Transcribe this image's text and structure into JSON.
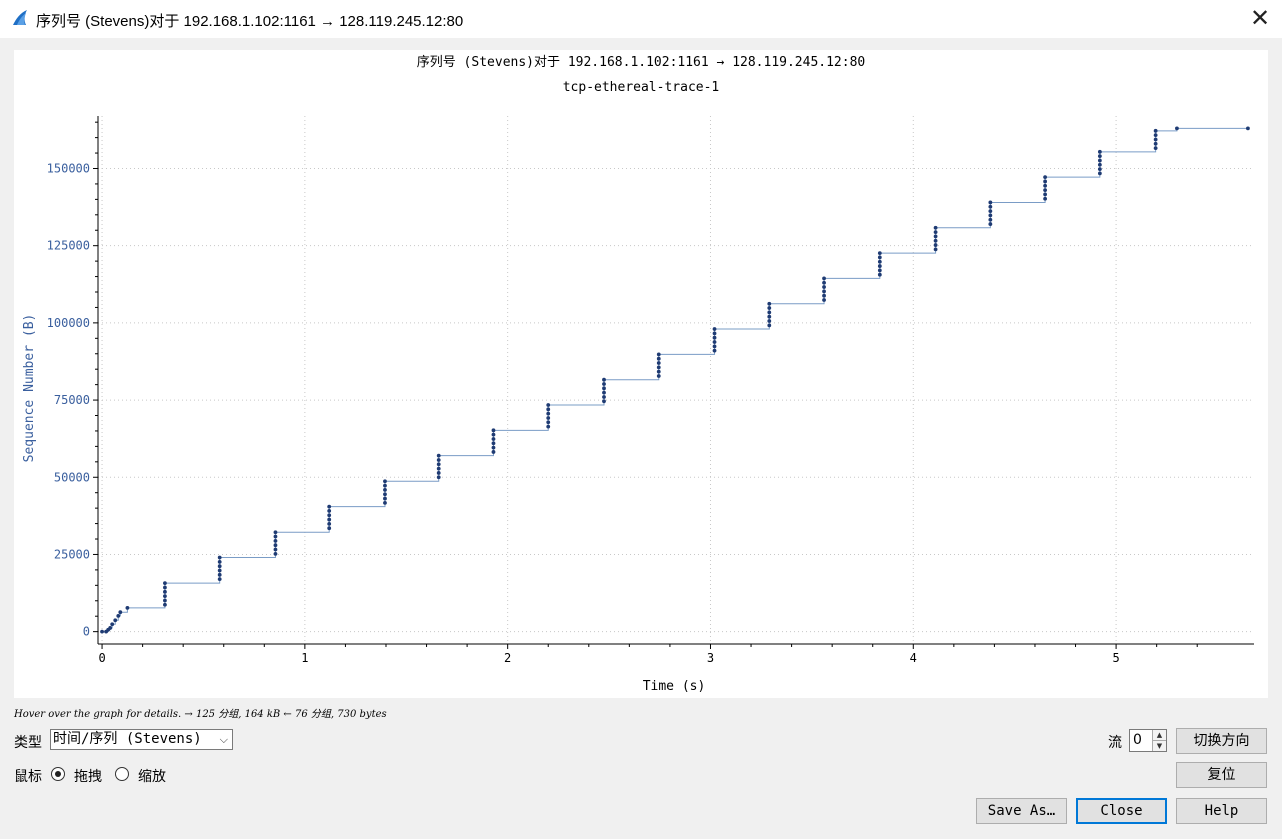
{
  "window": {
    "title": "序列号 (Stevens)对于 192.168.1.102:1161 → 128.119.245.12:80",
    "close_glyph": "✕"
  },
  "plot": {
    "title": "序列号 (Stevens)对于 192.168.1.102:1161 → 128.119.245.12:80",
    "subtitle": "tcp-ethereal-trace-1"
  },
  "chart_data": {
    "type": "scatter",
    "title": "序列号 (Stevens)对于 192.168.1.102:1161 → 128.119.245.12:80",
    "subtitle": "tcp-ethereal-trace-1",
    "xlabel": "Time (s)",
    "ylabel": "Sequence Number (B)",
    "xlim": [
      -0.02,
      5.68
    ],
    "ylim": [
      -4000,
      167000
    ],
    "x_ticks": [
      0,
      1,
      2,
      3,
      4,
      5
    ],
    "y_ticks": [
      0,
      25000,
      50000,
      75000,
      100000,
      125000,
      150000
    ],
    "grid": true,
    "line_color": "#7a9cc6",
    "point_color": "#1f3b73",
    "points": [
      [
        0.0,
        0
      ],
      [
        0.02,
        0
      ],
      [
        0.03,
        600
      ],
      [
        0.04,
        1200
      ],
      [
        0.05,
        2400
      ],
      [
        0.065,
        3700
      ],
      [
        0.08,
        5100
      ],
      [
        0.09,
        6300
      ],
      [
        0.125,
        7700
      ],
      [
        0.31,
        8700
      ],
      [
        0.31,
        10100
      ],
      [
        0.31,
        11500
      ],
      [
        0.31,
        12900
      ],
      [
        0.31,
        14300
      ],
      [
        0.31,
        15700
      ],
      [
        0.58,
        17000
      ],
      [
        0.58,
        18400
      ],
      [
        0.58,
        19800
      ],
      [
        0.58,
        21200
      ],
      [
        0.58,
        22600
      ],
      [
        0.58,
        24000
      ],
      [
        0.855,
        25200
      ],
      [
        0.855,
        26600
      ],
      [
        0.855,
        28000
      ],
      [
        0.855,
        29400
      ],
      [
        0.855,
        30800
      ],
      [
        0.855,
        32200
      ],
      [
        1.12,
        33500
      ],
      [
        1.12,
        34900
      ],
      [
        1.12,
        36300
      ],
      [
        1.12,
        37700
      ],
      [
        1.12,
        39100
      ],
      [
        1.12,
        40500
      ],
      [
        1.395,
        41700
      ],
      [
        1.395,
        43100
      ],
      [
        1.395,
        44500
      ],
      [
        1.395,
        45900
      ],
      [
        1.395,
        47300
      ],
      [
        1.395,
        48700
      ],
      [
        1.66,
        50000
      ],
      [
        1.66,
        51400
      ],
      [
        1.66,
        52800
      ],
      [
        1.66,
        54200
      ],
      [
        1.66,
        55600
      ],
      [
        1.66,
        57000
      ],
      [
        1.93,
        58200
      ],
      [
        1.93,
        59600
      ],
      [
        1.93,
        61000
      ],
      [
        1.93,
        62400
      ],
      [
        1.93,
        63800
      ],
      [
        1.93,
        65200
      ],
      [
        2.2,
        66400
      ],
      [
        2.2,
        67800
      ],
      [
        2.2,
        69200
      ],
      [
        2.2,
        70600
      ],
      [
        2.2,
        72000
      ],
      [
        2.2,
        73400
      ],
      [
        2.475,
        74600
      ],
      [
        2.475,
        76000
      ],
      [
        2.475,
        77400
      ],
      [
        2.475,
        78800
      ],
      [
        2.475,
        80200
      ],
      [
        2.475,
        81600
      ],
      [
        2.745,
        82800
      ],
      [
        2.745,
        84200
      ],
      [
        2.745,
        85600
      ],
      [
        2.745,
        87000
      ],
      [
        2.745,
        88400
      ],
      [
        2.745,
        89800
      ],
      [
        3.02,
        91000
      ],
      [
        3.02,
        92400
      ],
      [
        3.02,
        93800
      ],
      [
        3.02,
        95200
      ],
      [
        3.02,
        96600
      ],
      [
        3.02,
        98000
      ],
      [
        3.29,
        99200
      ],
      [
        3.29,
        100600
      ],
      [
        3.29,
        102000
      ],
      [
        3.29,
        103400
      ],
      [
        3.29,
        104800
      ],
      [
        3.29,
        106200
      ],
      [
        3.56,
        107400
      ],
      [
        3.56,
        108800
      ],
      [
        3.56,
        110200
      ],
      [
        3.56,
        111600
      ],
      [
        3.56,
        113000
      ],
      [
        3.56,
        114400
      ],
      [
        3.835,
        115600
      ],
      [
        3.835,
        117000
      ],
      [
        3.835,
        118400
      ],
      [
        3.835,
        119800
      ],
      [
        3.835,
        121200
      ],
      [
        3.835,
        122600
      ],
      [
        4.11,
        123800
      ],
      [
        4.11,
        125200
      ],
      [
        4.11,
        126600
      ],
      [
        4.11,
        128000
      ],
      [
        4.11,
        129400
      ],
      [
        4.11,
        130800
      ],
      [
        4.38,
        132000
      ],
      [
        4.38,
        133400
      ],
      [
        4.38,
        134800
      ],
      [
        4.38,
        136200
      ],
      [
        4.38,
        137600
      ],
      [
        4.38,
        139000
      ],
      [
        4.65,
        140200
      ],
      [
        4.65,
        141600
      ],
      [
        4.65,
        143000
      ],
      [
        4.65,
        144400
      ],
      [
        4.65,
        145800
      ],
      [
        4.65,
        147200
      ],
      [
        4.92,
        148400
      ],
      [
        4.92,
        149800
      ],
      [
        4.92,
        151200
      ],
      [
        4.92,
        152600
      ],
      [
        4.92,
        154000
      ],
      [
        4.92,
        155400
      ],
      [
        5.195,
        156600
      ],
      [
        5.195,
        158000
      ],
      [
        5.195,
        159400
      ],
      [
        5.195,
        160800
      ],
      [
        5.195,
        162200
      ],
      [
        5.3,
        163000
      ],
      [
        5.65,
        163000
      ]
    ]
  },
  "status": {
    "hint": "Hover over the graph for details. → 125 分组, 164 kB ← 76 分组, 730 bytes"
  },
  "controls": {
    "type_label": "类型",
    "type_value": "时间/序列 (Stevens)",
    "mouse_label": "鼠标",
    "drag_label": "拖拽",
    "zoom_label": "缩放",
    "stream_label": "流",
    "stream_value": "0",
    "switch_direction_label": "切换方向",
    "reset_label": "复位",
    "save_as_label": "Save As…",
    "close_label": "Close",
    "help_label": "Help"
  }
}
